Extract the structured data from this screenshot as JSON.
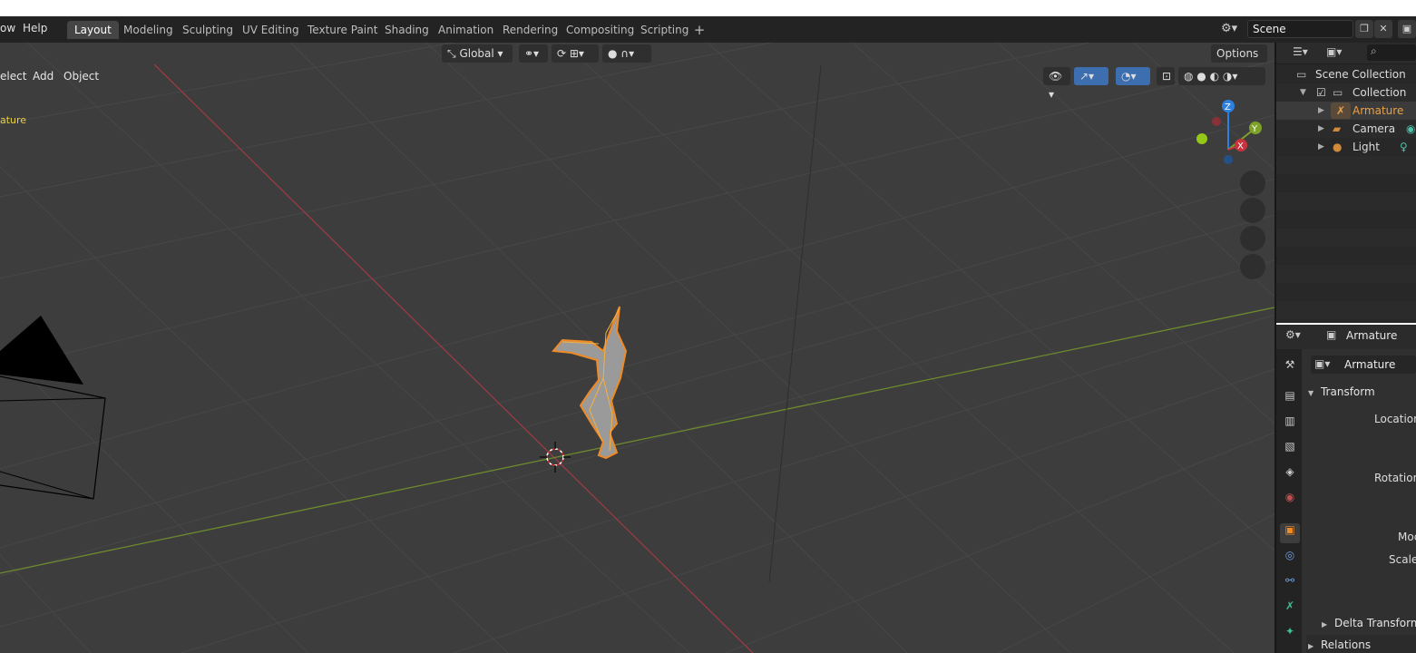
{
  "menu": {
    "window_partial": "ow",
    "help": "Help"
  },
  "workspaces": [
    "Layout",
    "Modeling",
    "Sculpting",
    "UV Editing",
    "Texture Paint",
    "Shading",
    "Animation",
    "Rendering",
    "Compositing",
    "Scripting"
  ],
  "active_workspace": "Layout",
  "scene": {
    "name": "Scene"
  },
  "viewport": {
    "header": {
      "select_partial": "elect",
      "add": "Add",
      "object": "Object",
      "orientation": "Global",
      "options": "Options"
    },
    "active_object_label_partial": "ature",
    "gizmo_axes": {
      "z": "Z",
      "y": "Y",
      "x": "X"
    }
  },
  "outliner": {
    "scene_collection": "Scene Collection",
    "collection": "Collection",
    "items": [
      "Armature",
      "Camera",
      "Light"
    ]
  },
  "properties": {
    "object_name_header": "Armature",
    "object_name_field": "Armature",
    "transform_section": "Transform",
    "location_label": "Location",
    "rotation_label": "Rotation",
    "mode_label_partial": "Moc",
    "scale_label": "Scale",
    "delta_transform": "Delta Transform",
    "relations": "Relations"
  },
  "colors": {
    "accent_selected": "#f08a24",
    "active_tab": "#454545",
    "x_axis": "#c8343d",
    "y_axis": "#7ea12a",
    "z_axis": "#2d7fe0"
  }
}
